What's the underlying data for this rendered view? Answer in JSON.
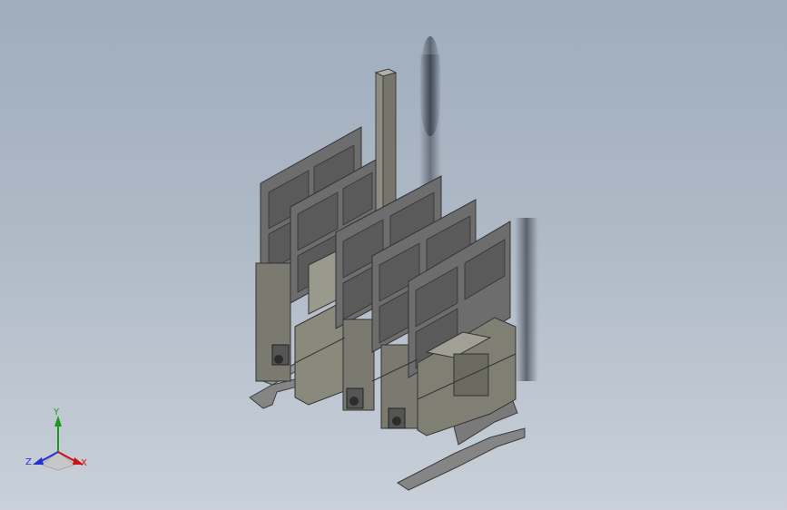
{
  "viewport": {
    "background_top": "#9fadbd",
    "background_bottom": "#c9d0d9"
  },
  "model": {
    "body_color": "#8a8a7c",
    "body_dark": "#5e5e54",
    "panel_color": "#6e6e6e",
    "panel_dark": "#4a4a4a",
    "bracket_color": "#7f7f7f",
    "plate_count": 5
  },
  "triad": {
    "x_label": "X",
    "y_label": "Y",
    "z_label": "Z",
    "x_color": "#cc1111",
    "y_color": "#1a9a1a",
    "z_color": "#2233cc"
  }
}
